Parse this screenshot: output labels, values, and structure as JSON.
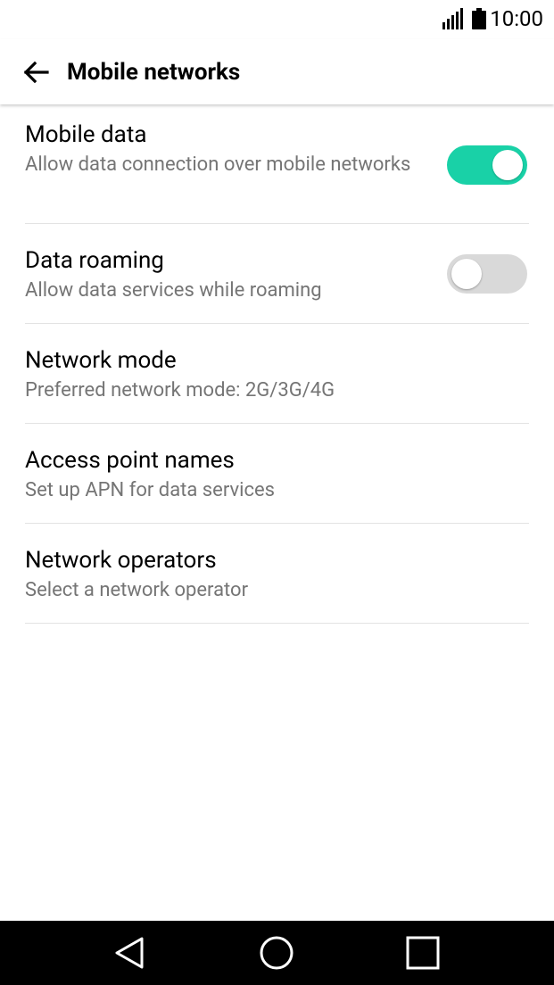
{
  "status_bar": {
    "time": "10:00",
    "signal_icon": "signal-strength-icon",
    "battery_icon": "battery-full-icon"
  },
  "app_bar": {
    "title": "Mobile networks",
    "back_icon": "arrow-back-icon"
  },
  "settings": [
    {
      "title": "Mobile data",
      "subtitle": "Allow data connection over mobile networks",
      "toggle": "on"
    },
    {
      "title": "Data roaming",
      "subtitle": "Allow data services while roaming",
      "toggle": "off"
    },
    {
      "title": "Network mode",
      "subtitle": "Preferred network mode: 2G/3G/4G"
    },
    {
      "title": "Access point names",
      "subtitle": "Set up APN for data services"
    },
    {
      "title": "Network operators",
      "subtitle": "Select a network operator"
    }
  ],
  "nav_bar": {
    "back_icon": "triangle-back-icon",
    "home_icon": "circle-home-icon",
    "recents_icon": "square-recents-icon"
  },
  "colors": {
    "accent": "#19d1a7",
    "toggle_off": "#d9d9d9",
    "secondary_text": "#757575",
    "nav_bar": "#000000"
  }
}
